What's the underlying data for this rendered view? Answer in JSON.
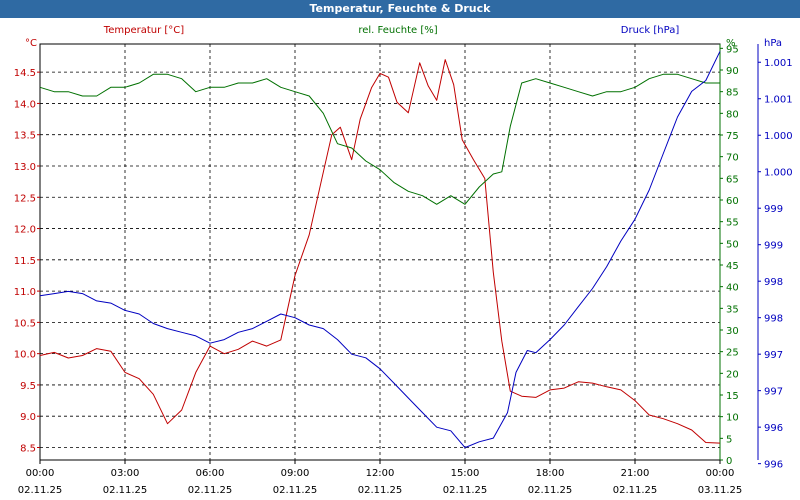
{
  "title": "Temperatur, Feuchte & Druck",
  "chart_data": {
    "type": "line",
    "title": "Temperatur, Feuchte & Druck",
    "grid": true,
    "x_axis": {
      "range": [
        "02.11.25 00:00",
        "03.11.25 00:00"
      ],
      "ticks": [
        {
          "time": "00:00",
          "date": "02.11.25"
        },
        {
          "time": "03:00",
          "date": "02.11.25"
        },
        {
          "time": "06:00",
          "date": "02.11.25"
        },
        {
          "time": "09:00",
          "date": "02.11.25"
        },
        {
          "time": "12:00",
          "date": "02.11.25"
        },
        {
          "time": "15:00",
          "date": "02.11.25"
        },
        {
          "time": "18:00",
          "date": "02.11.25"
        },
        {
          "time": "21:00",
          "date": "02.11.25"
        },
        {
          "time": "00:00",
          "date": "03.11.25"
        }
      ]
    },
    "axes": {
      "temperature": {
        "unit": "°C",
        "label": "Temperatur [°C]",
        "color": "#c00000",
        "ylim": [
          8.3,
          14.95
        ],
        "ticks": [
          "14.5",
          "14.0",
          "13.5",
          "13.0",
          "12.5",
          "12.0",
          "11.5",
          "11.0",
          "10.5",
          "10.0",
          "9.5",
          "9.0",
          "8.5"
        ],
        "tick_values": [
          14.5,
          14.0,
          13.5,
          13.0,
          12.5,
          12.0,
          11.5,
          11.0,
          10.5,
          10.0,
          9.5,
          9.0,
          8.5
        ]
      },
      "humidity": {
        "unit": "%",
        "label": "rel. Feuchte [%]",
        "color": "#007000",
        "ylim": [
          0,
          96
        ],
        "ticks": [
          "95",
          "90",
          "85",
          "80",
          "75",
          "70",
          "65",
          "60",
          "55",
          "50",
          "45",
          "40",
          "35",
          "30",
          "25",
          "20",
          "15",
          "10",
          "5",
          "0"
        ],
        "tick_values": [
          95,
          90,
          85,
          80,
          75,
          70,
          65,
          60,
          55,
          50,
          45,
          40,
          35,
          30,
          25,
          20,
          15,
          10,
          5,
          0
        ]
      },
      "pressure": {
        "unit": "hPa",
        "label": "Druck [hPa]",
        "color": "#0000c0",
        "ylim": [
          995.75,
          1001.45
        ],
        "ticks": [
          "1.001",
          "1.001",
          "1.000",
          "1.000",
          "999",
          "999",
          "998",
          "998",
          "997",
          "997",
          "996",
          "996"
        ],
        "tick_values": [
          1001.2,
          1000.7,
          1000.2,
          999.7,
          999.2,
          998.7,
          998.2,
          997.7,
          997.2,
          996.7,
          996.2,
          995.7
        ]
      }
    },
    "series": [
      {
        "name": "Temperatur [°C]",
        "axis": "temperature",
        "color": "#c00000",
        "points": [
          [
            0,
            9.97
          ],
          [
            0.5,
            10.02
          ],
          [
            1,
            9.93
          ],
          [
            1.5,
            9.97
          ],
          [
            2,
            10.08
          ],
          [
            2.5,
            10.04
          ],
          [
            3,
            9.7
          ],
          [
            3.5,
            9.6
          ],
          [
            4,
            9.35
          ],
          [
            4.5,
            8.88
          ],
          [
            5,
            9.1
          ],
          [
            5.5,
            9.7
          ],
          [
            6,
            10.12
          ],
          [
            6.5,
            10.0
          ],
          [
            7,
            10.07
          ],
          [
            7.5,
            10.2
          ],
          [
            8,
            10.12
          ],
          [
            8.5,
            10.22
          ],
          [
            9,
            11.25
          ],
          [
            9.5,
            11.9
          ],
          [
            10,
            12.9
          ],
          [
            10.3,
            13.5
          ],
          [
            10.6,
            13.62
          ],
          [
            11,
            13.1
          ],
          [
            11.3,
            13.75
          ],
          [
            11.7,
            14.25
          ],
          [
            12,
            14.48
          ],
          [
            12.3,
            14.42
          ],
          [
            12.6,
            14.02
          ],
          [
            13,
            13.85
          ],
          [
            13.4,
            14.65
          ],
          [
            13.7,
            14.28
          ],
          [
            14,
            14.05
          ],
          [
            14.3,
            14.7
          ],
          [
            14.6,
            14.3
          ],
          [
            14.9,
            13.42
          ],
          [
            15.3,
            13.1
          ],
          [
            15.7,
            12.8
          ],
          [
            16,
            11.3
          ],
          [
            16.3,
            10.2
          ],
          [
            16.6,
            9.4
          ],
          [
            17,
            9.32
          ],
          [
            17.5,
            9.3
          ],
          [
            18,
            9.42
          ],
          [
            18.5,
            9.45
          ],
          [
            19,
            9.55
          ],
          [
            19.5,
            9.53
          ],
          [
            20,
            9.47
          ],
          [
            20.5,
            9.42
          ],
          [
            21,
            9.25
          ],
          [
            21.5,
            9.02
          ],
          [
            22,
            8.96
          ],
          [
            22.5,
            8.88
          ],
          [
            23,
            8.78
          ],
          [
            23.5,
            8.58
          ],
          [
            24,
            8.57
          ]
        ]
      },
      {
        "name": "rel. Feuchte [%]",
        "axis": "humidity",
        "color": "#007000",
        "points": [
          [
            0,
            86
          ],
          [
            0.5,
            85
          ],
          [
            1,
            85
          ],
          [
            1.5,
            84
          ],
          [
            2,
            84
          ],
          [
            2.5,
            86
          ],
          [
            3,
            86
          ],
          [
            3.5,
            87
          ],
          [
            4,
            89
          ],
          [
            4.5,
            89
          ],
          [
            5,
            88
          ],
          [
            5.5,
            85
          ],
          [
            6,
            86
          ],
          [
            6.5,
            86
          ],
          [
            7,
            87
          ],
          [
            7.5,
            87
          ],
          [
            8,
            88
          ],
          [
            8.5,
            86
          ],
          [
            9,
            85
          ],
          [
            9.5,
            84
          ],
          [
            10,
            80
          ],
          [
            10.5,
            73
          ],
          [
            11,
            72
          ],
          [
            11.5,
            69
          ],
          [
            12,
            67
          ],
          [
            12.5,
            64
          ],
          [
            13,
            62
          ],
          [
            13.5,
            61
          ],
          [
            14,
            59
          ],
          [
            14.5,
            61
          ],
          [
            15,
            59
          ],
          [
            15.5,
            63
          ],
          [
            16,
            66
          ],
          [
            16.3,
            66.5
          ],
          [
            16.6,
            77
          ],
          [
            17,
            87
          ],
          [
            17.5,
            88
          ],
          [
            18,
            87
          ],
          [
            18.5,
            86
          ],
          [
            19,
            85
          ],
          [
            19.5,
            84
          ],
          [
            20,
            85
          ],
          [
            20.5,
            85
          ],
          [
            21,
            86
          ],
          [
            21.5,
            88
          ],
          [
            22,
            89
          ],
          [
            22.5,
            89
          ],
          [
            23,
            88
          ],
          [
            23.5,
            87
          ],
          [
            24,
            87
          ]
        ]
      },
      {
        "name": "Druck [hPa]",
        "axis": "pressure",
        "color": "#0000c0",
        "points": [
          [
            0,
            998.0
          ],
          [
            0.5,
            998.03
          ],
          [
            1,
            998.06
          ],
          [
            1.5,
            998.03
          ],
          [
            2,
            997.93
          ],
          [
            2.5,
            997.9
          ],
          [
            3,
            997.8
          ],
          [
            3.5,
            997.75
          ],
          [
            4,
            997.62
          ],
          [
            4.5,
            997.55
          ],
          [
            5,
            997.5
          ],
          [
            5.5,
            997.45
          ],
          [
            6,
            997.35
          ],
          [
            6.5,
            997.4
          ],
          [
            7,
            997.5
          ],
          [
            7.5,
            997.55
          ],
          [
            8,
            997.65
          ],
          [
            8.5,
            997.75
          ],
          [
            9,
            997.7
          ],
          [
            9.5,
            997.6
          ],
          [
            10,
            997.55
          ],
          [
            10.5,
            997.4
          ],
          [
            11,
            997.2
          ],
          [
            11.5,
            997.15
          ],
          [
            12,
            997.0
          ],
          [
            12.5,
            996.8
          ],
          [
            13,
            996.6
          ],
          [
            13.5,
            996.4
          ],
          [
            14,
            996.2
          ],
          [
            14.5,
            996.15
          ],
          [
            15,
            995.92
          ],
          [
            15.5,
            996.0
          ],
          [
            16,
            996.05
          ],
          [
            16.5,
            996.4
          ],
          [
            16.8,
            996.95
          ],
          [
            17.2,
            997.25
          ],
          [
            17.5,
            997.22
          ],
          [
            18,
            997.4
          ],
          [
            18.5,
            997.6
          ],
          [
            19,
            997.85
          ],
          [
            19.5,
            998.1
          ],
          [
            20,
            998.4
          ],
          [
            20.5,
            998.75
          ],
          [
            21,
            999.05
          ],
          [
            21.5,
            999.45
          ],
          [
            22,
            999.95
          ],
          [
            22.5,
            1000.45
          ],
          [
            23,
            1000.8
          ],
          [
            23.5,
            1000.95
          ],
          [
            24,
            1001.35
          ]
        ]
      }
    ]
  }
}
